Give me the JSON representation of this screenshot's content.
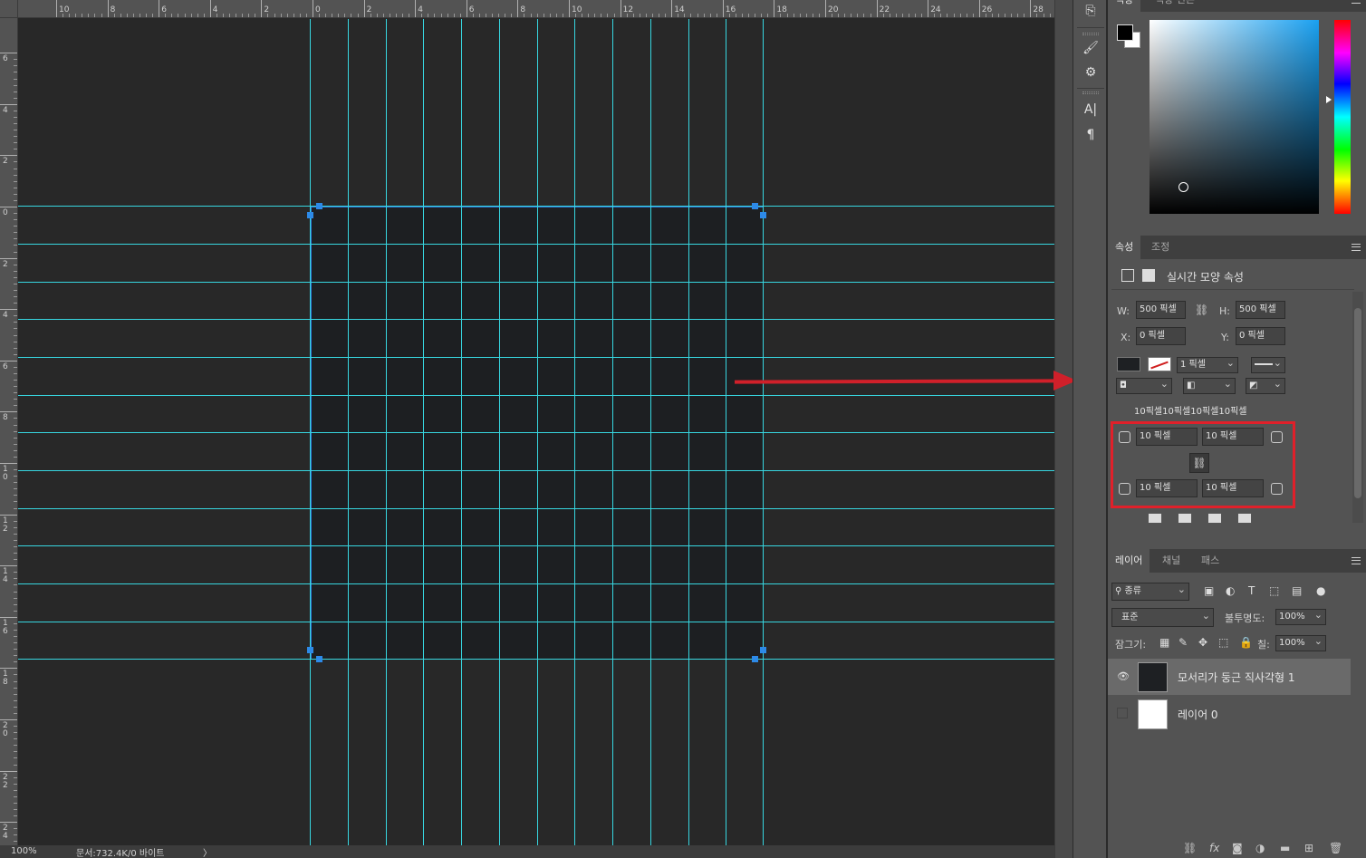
{
  "rulers": {
    "top_labels": [
      "10",
      "8",
      "6",
      "4",
      "2",
      "0",
      "2",
      "4",
      "6",
      "8",
      "10",
      "12",
      "14",
      "16",
      "18",
      "20",
      "22",
      "24",
      "26",
      "28"
    ],
    "left_labels": [
      "6",
      "4",
      "2",
      "0",
      "2",
      "4",
      "6",
      "8",
      "10",
      "12",
      "14",
      "16",
      "18",
      "20",
      "22",
      "24"
    ]
  },
  "statusbar": {
    "zoom": "100%",
    "doc": "문서:732.4K/0 바이트",
    "arrow": "〉"
  },
  "color_panel": {
    "tabs": [
      "색상",
      "색상 견본"
    ],
    "foreground": "#000000",
    "background": "#ffffff"
  },
  "properties_panel": {
    "tabs": [
      "속성",
      "조정"
    ],
    "title": "실시간 모양 속성",
    "w_label": "W:",
    "w_value": "500 픽셀",
    "h_label": "H:",
    "h_value": "500 픽셀",
    "x_label": "X:",
    "x_value": "0 픽셀",
    "y_label": "Y:",
    "y_value": "0 픽셀",
    "stroke_width": "1 픽셀",
    "corner_summary": "10픽셀10픽셀10픽셀10픽셀",
    "corner_tl": "10 픽셀",
    "corner_tr": "10 픽셀",
    "corner_bl": "10 픽셀",
    "corner_br": "10 픽셀",
    "fill_color": "#1e2023"
  },
  "layers_panel": {
    "tabs": [
      "레이어",
      "채널",
      "패스"
    ],
    "filter_kind": "종류",
    "blend_mode": "표준",
    "opacity_label": "불투명도:",
    "opacity_value": "100%",
    "lock_label": "잠그기:",
    "fill_label": "칠:",
    "fill_value": "100%",
    "layers": [
      {
        "name": "모서리가 둥근 직사각형 1",
        "visible": true,
        "selected": true
      },
      {
        "name": "레이어 0",
        "visible": false,
        "selected": false
      }
    ]
  },
  "annotation": {
    "highlight_color": "#e0202a"
  }
}
